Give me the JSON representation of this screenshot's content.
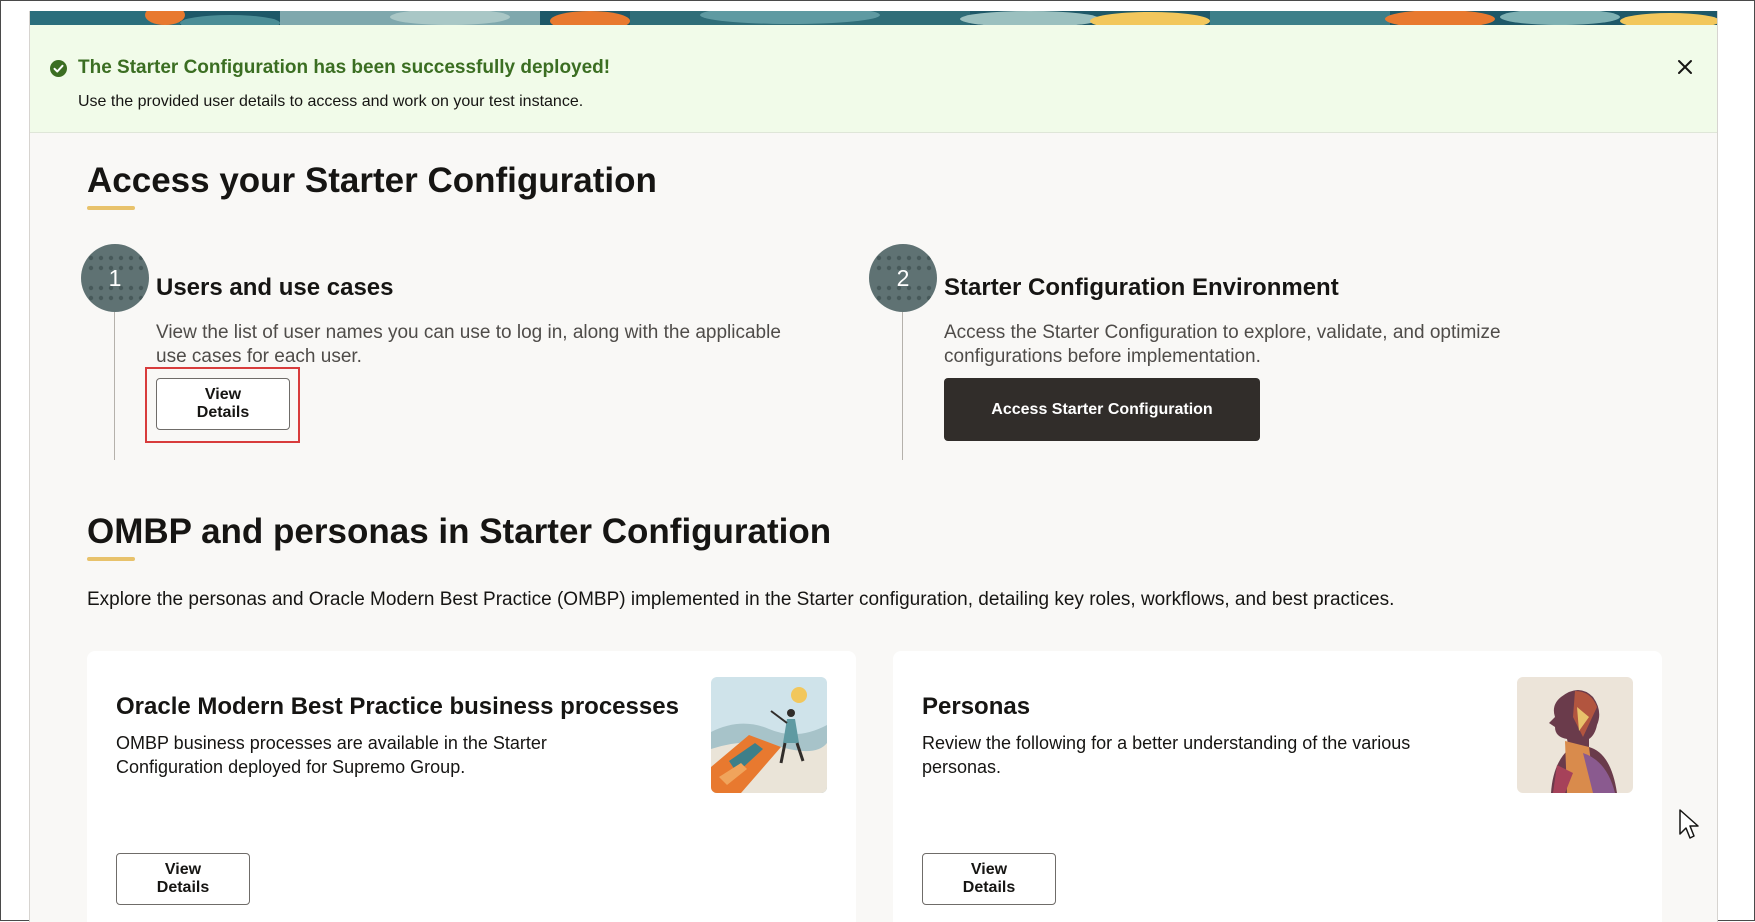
{
  "toast": {
    "title": "The Starter Configuration has been successfully deployed!",
    "body": "Use the provided user details to access and work on your test instance.",
    "icon": "check-circle-icon",
    "close_icon": "close-icon",
    "accent": "#3b6e22"
  },
  "access": {
    "title": "Access your Starter Configuration",
    "steps": [
      {
        "number": "1",
        "title": "Users and use cases",
        "description": "View the list of user names you can use to log in, along with the applicable use cases for each user.",
        "button": "View Details"
      },
      {
        "number": "2",
        "title": "Starter Configuration Environment",
        "description": "Access the Starter Configuration to explore, validate, and optimize configurations before implementation.",
        "button": "Access Starter Configuration"
      }
    ]
  },
  "ombp": {
    "title": "OMBP and personas in Starter Configuration",
    "intro": "Explore the personas and Oracle Modern Best Practice (OMBP) implemented in the Starter configuration, detailing key roles, workflows, and best practices.",
    "cards": [
      {
        "title": "Oracle Modern Best Practice business processes",
        "description": "OMBP business processes are available in the Starter Configuration deployed for Supremo Group.",
        "button": "View Details"
      },
      {
        "title": "Personas",
        "description": "Review the following for a better understanding of the various personas.",
        "button": "View Details"
      }
    ]
  },
  "colors": {
    "underline": "#e8c26b",
    "dark_button": "#312d2a",
    "highlight": "#d83c3c"
  }
}
